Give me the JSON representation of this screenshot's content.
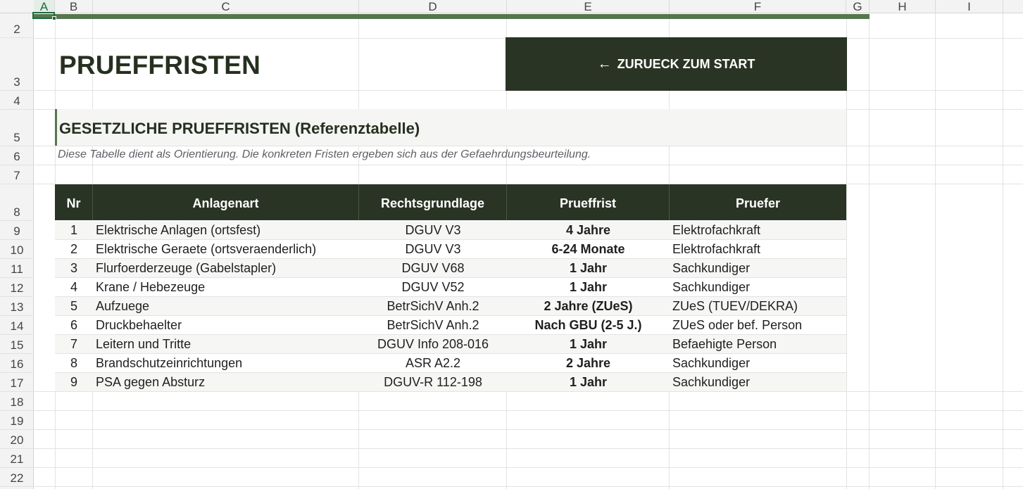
{
  "sheet": {
    "columns": [
      "A",
      "B",
      "C",
      "D",
      "E",
      "F",
      "G",
      "H",
      "I"
    ],
    "selected_column": "A",
    "rows": [
      "2",
      "3",
      "4",
      "5",
      "6",
      "7",
      "8",
      "9",
      "10",
      "11",
      "12",
      "13",
      "14",
      "15",
      "16",
      "17",
      "18",
      "19",
      "20",
      "21",
      "22"
    ]
  },
  "header": {
    "title": "PRUEFFRISTEN",
    "back_button_label": "ZURUECK ZUM START",
    "back_button_icon": "arrow-left-icon"
  },
  "section": {
    "title": "GESETZLICHE PRUEFFRISTEN (Referenztabelle)",
    "subtitle": "Diese Tabelle dient als Orientierung. Die konkreten Fristen ergeben sich aus der Gefaehrdungsbeurteilung."
  },
  "table": {
    "headers": [
      "Nr",
      "Anlagenart",
      "Rechtsgrundlage",
      "Prueffrist",
      "Pruefer"
    ],
    "rows": [
      {
        "nr": "1",
        "anlage": "Elektrische Anlagen (ortsfest)",
        "recht": "DGUV V3",
        "frist": "4 Jahre",
        "pruefer": "Elektrofachkraft"
      },
      {
        "nr": "2",
        "anlage": "Elektrische Geraete (ortsveraenderlich)",
        "recht": "DGUV V3",
        "frist": "6-24 Monate",
        "pruefer": "Elektrofachkraft"
      },
      {
        "nr": "3",
        "anlage": "Flurfoerderzeuge (Gabelstapler)",
        "recht": "DGUV V68",
        "frist": "1 Jahr",
        "pruefer": "Sachkundiger"
      },
      {
        "nr": "4",
        "anlage": "Krane / Hebezeuge",
        "recht": "DGUV V52",
        "frist": "1 Jahr",
        "pruefer": "Sachkundiger"
      },
      {
        "nr": "5",
        "anlage": "Aufzuege",
        "recht": "BetrSichV Anh.2",
        "frist": "2 Jahre (ZUeS)",
        "pruefer": "ZUeS (TUEV/DEKRA)"
      },
      {
        "nr": "6",
        "anlage": "Druckbehaelter",
        "recht": "BetrSichV Anh.2",
        "frist": "Nach GBU (2-5 J.)",
        "pruefer": "ZUeS oder bef. Person"
      },
      {
        "nr": "7",
        "anlage": "Leitern und Tritte",
        "recht": "DGUV Info 208-016",
        "frist": "1 Jahr",
        "pruefer": "Befaehigte Person"
      },
      {
        "nr": "8",
        "anlage": "Brandschutzeinrichtungen",
        "recht": "ASR A2.2",
        "frist": "2 Jahre",
        "pruefer": "Sachkundiger"
      },
      {
        "nr": "9",
        "anlage": "PSA gegen Absturz",
        "recht": "DGUV-R 112-198",
        "frist": "1 Jahr",
        "pruefer": "Sachkundiger"
      }
    ]
  },
  "colors": {
    "header_dark": "#2a3424",
    "accent_green": "#56764f",
    "excel_green": "#1e6b3c"
  }
}
